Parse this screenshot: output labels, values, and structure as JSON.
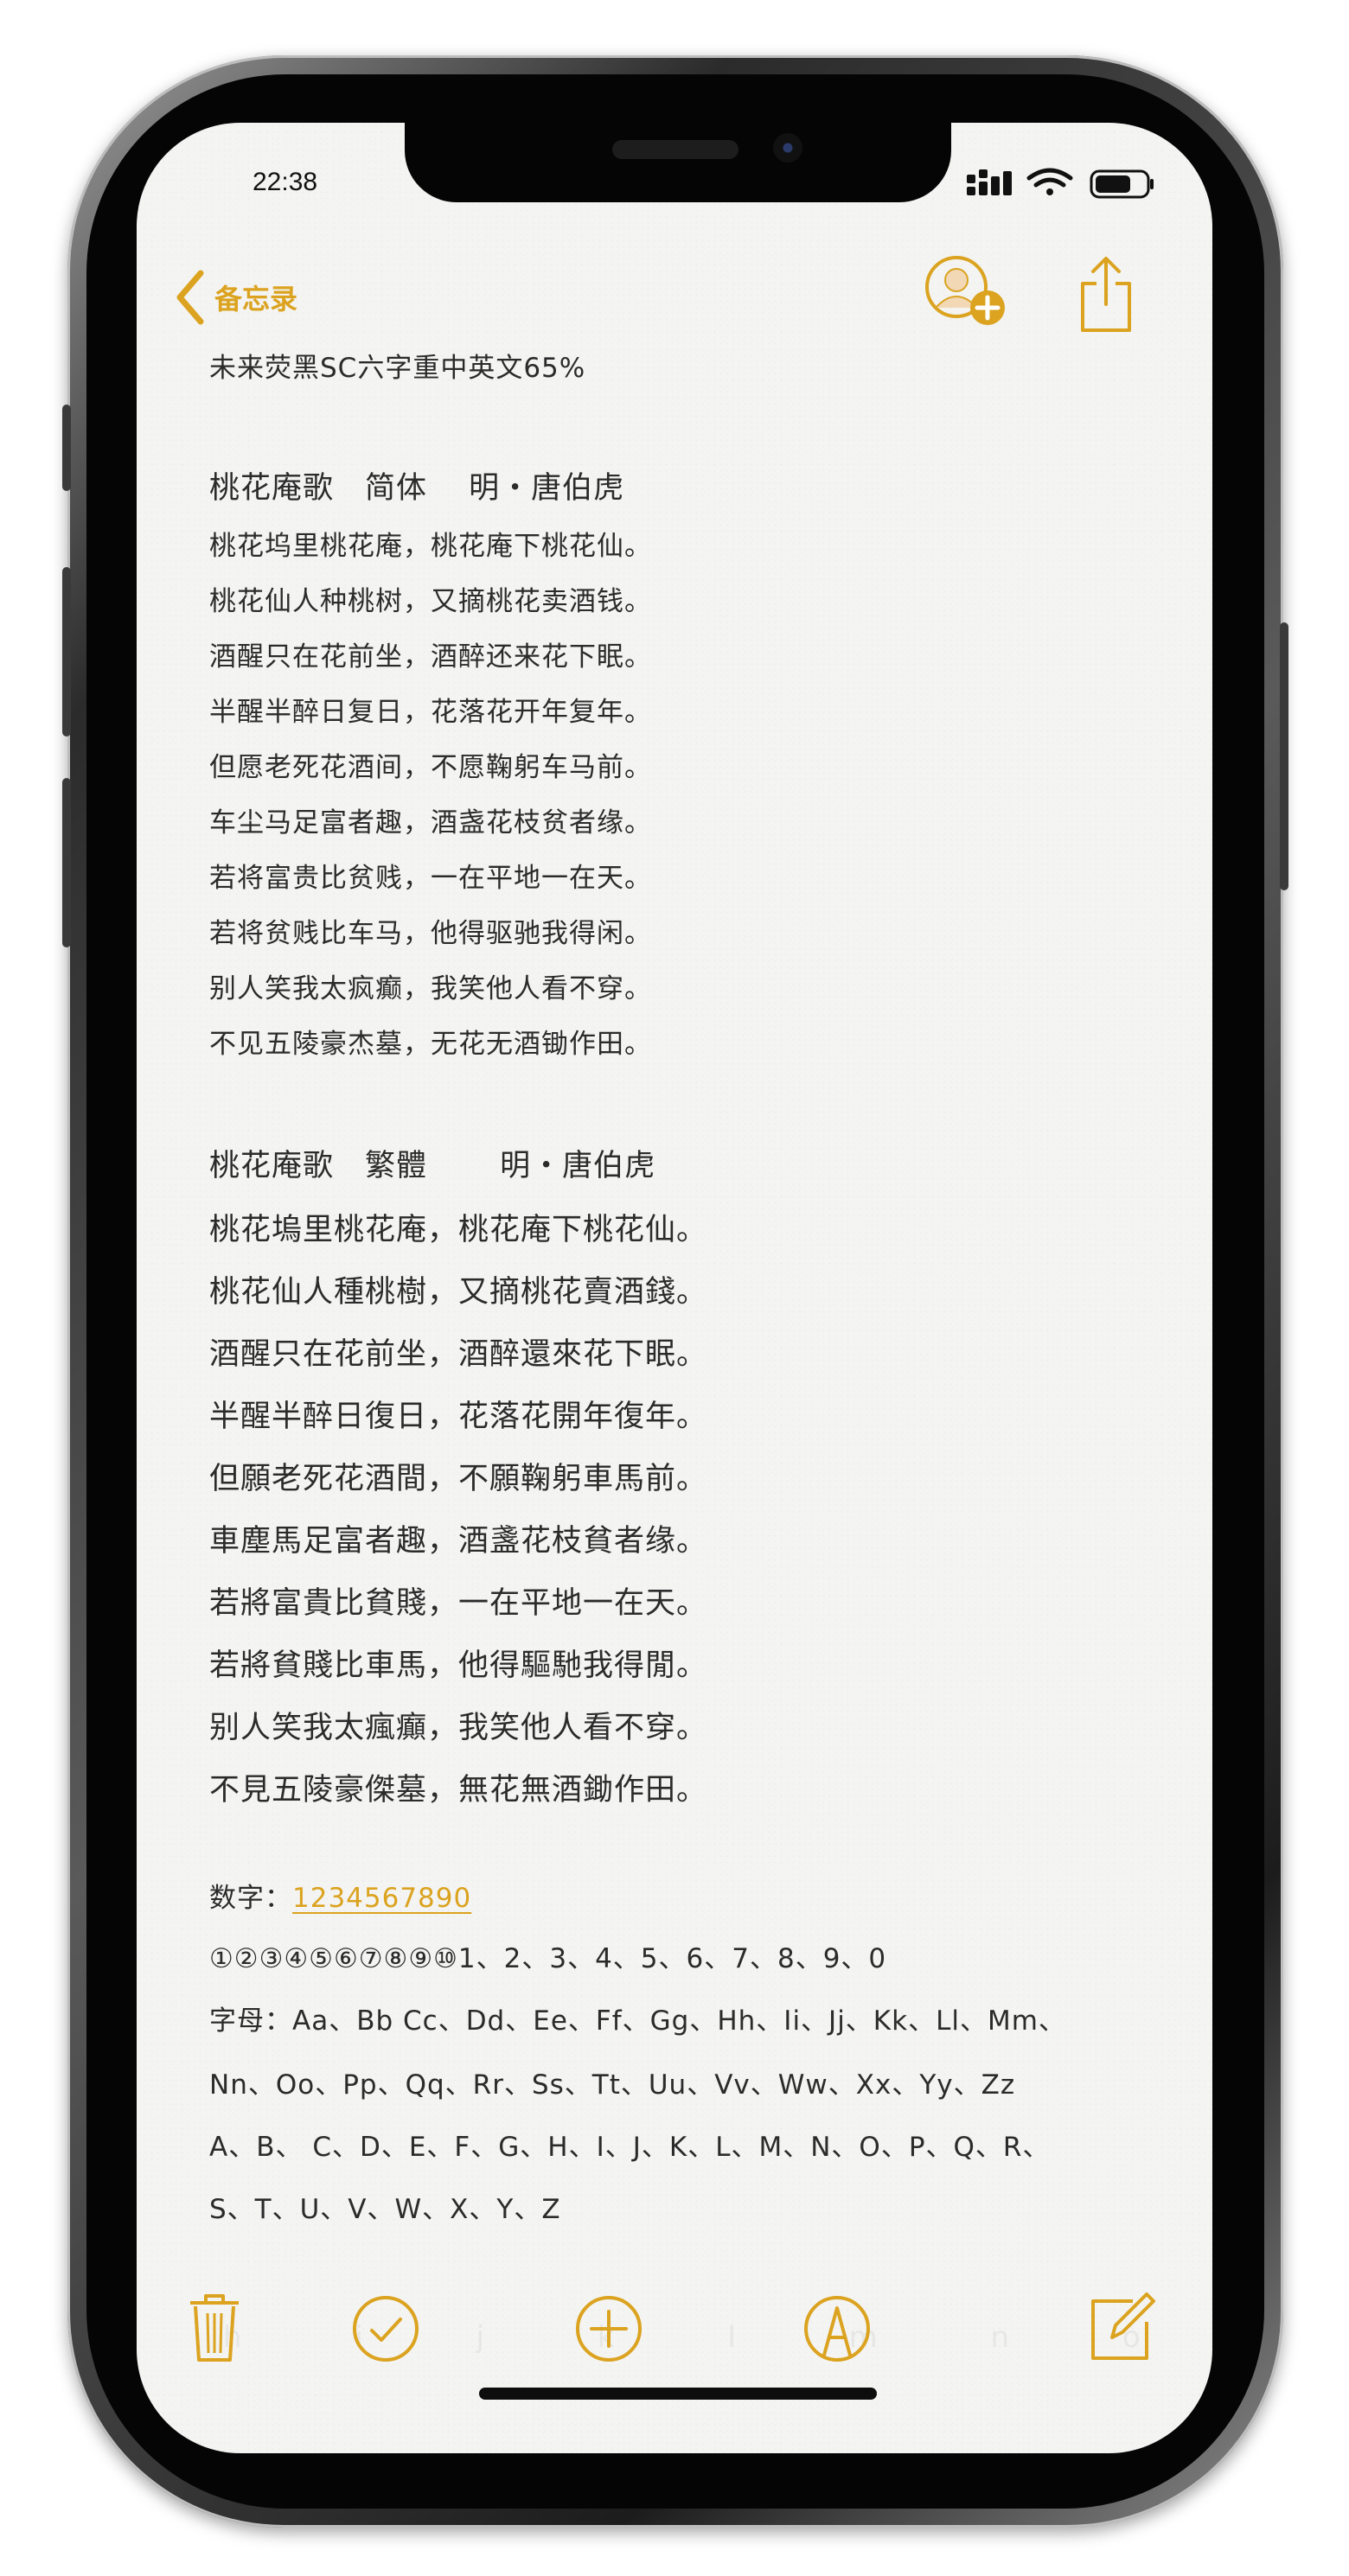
{
  "status_bar": {
    "time": "22:38"
  },
  "nav": {
    "back_label": "备忘录",
    "accent_color": "#dba31f",
    "icons": [
      "chevron-left-icon",
      "add-person-icon",
      "share-icon"
    ]
  },
  "note": {
    "header": "未来荧黑SC六字重中英文65%",
    "simplified": {
      "title": "桃花庵歌　简体　 明・唐伯虎",
      "lines": [
        "桃花坞里桃花庵，桃花庵下桃花仙。",
        "桃花仙人种桃树，又摘桃花卖酒钱。",
        "酒醒只在花前坐，酒醉还来花下眠。",
        "半醒半醉日复日，花落花开年复年。",
        "但愿老死花酒间，不愿鞠躬车马前。",
        "车尘马足富者趣，酒盏花枝贫者缘。",
        "若将富贵比贫贱，一在平地一在天。",
        "若将贫贱比车马，他得驱驰我得闲。",
        "别人笑我太疯癫，我笑他人看不穿。",
        "不见五陵豪杰墓，无花无酒锄作田。"
      ]
    },
    "traditional": {
      "title": "桃花庵歌　繁體　　 明・唐伯虎",
      "lines": [
        "桃花塢里桃花庵，桃花庵下桃花仙。",
        "桃花仙人種桃樹，又摘桃花賣酒錢。",
        "酒醒只在花前坐，酒醉還來花下眠。",
        "半醒半醉日復日，花落花開年復年。",
        "但願老死花酒間，不願鞠躬車馬前。",
        "車塵馬足富者趣，酒盞花枝貧者缘。",
        "若將富貴比貧賤，一在平地一在天。",
        "若將貧賤比車馬，他得驅馳我得閒。",
        "别人笑我太瘋癲，我笑他人看不穿。",
        "不見五陵豪傑墓，無花無酒鋤作田。"
      ]
    },
    "digits_label": "数字：",
    "digits_link": "1234567890",
    "circled_digits": "①②③④⑤⑥⑦⑧⑨⑩1、2、3、4、5、6、7、8、9、0",
    "letters_line1": "字母：Aa、Bb Cc、Dd、Ee、Ff、Gg、Hh、Ii、Jj、Kk、Ll、Mm、",
    "letters_line2": "Nn、Oo、Pp、Qq、Rr、Ss、Tt、Uu、Vv、Ww、Xx、Yy、Zz",
    "letters_line3": "A、B、 C、D、E、F、G、H、I、J、K、L、M、N、O、P、Q、R、",
    "letters_line4": "S、T、U、V、W、X、Y、Z",
    "ghost_text": "h i j k l m n o p q r s"
  },
  "toolbar": {
    "icons": [
      "trash-icon",
      "checklist-icon",
      "add-icon",
      "markup-icon",
      "compose-icon"
    ]
  }
}
